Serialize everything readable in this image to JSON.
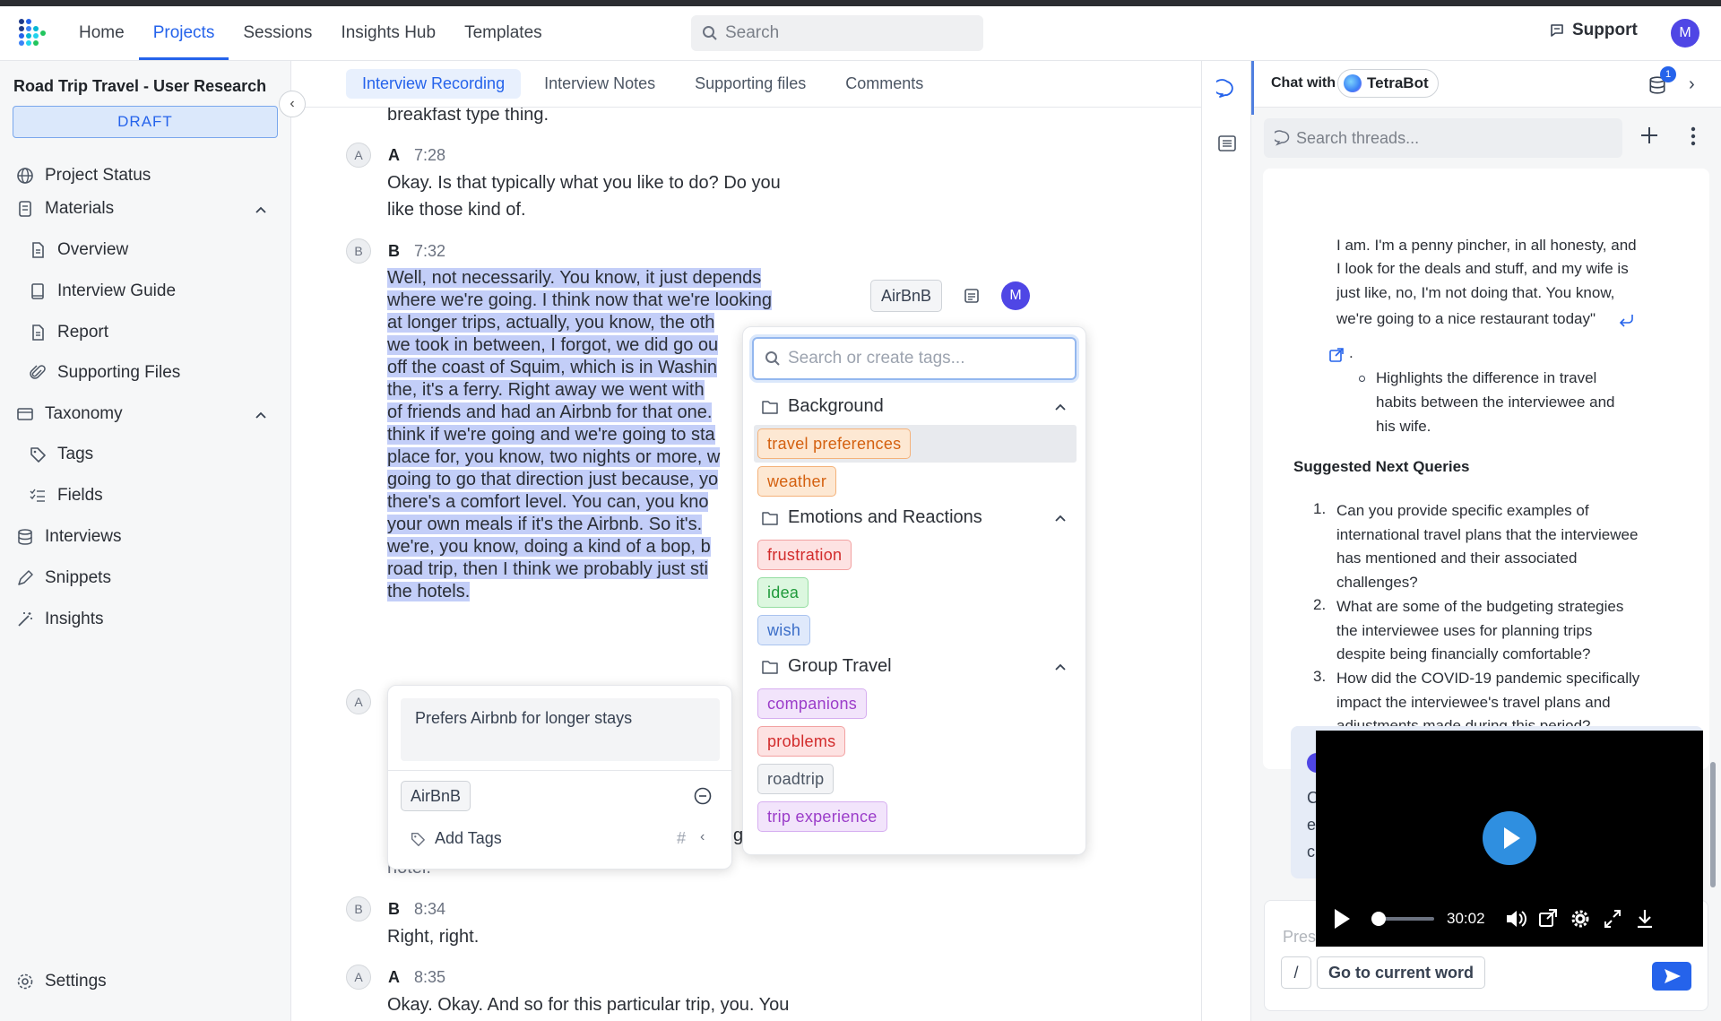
{
  "header": {
    "nav": [
      "Home",
      "Projects",
      "Sessions",
      "Insights Hub",
      "Templates"
    ],
    "active_nav": "Projects",
    "search_placeholder": "Search",
    "support_label": "Support",
    "user_initial": "M"
  },
  "sidebar": {
    "project_title": "Road Trip Travel - User Research",
    "status_badge": "DRAFT",
    "items": {
      "project_status": "Project Status",
      "materials": "Materials",
      "overview": "Overview",
      "interview_guide": "Interview Guide",
      "report": "Report",
      "supporting_files": "Supporting Files",
      "taxonomy": "Taxonomy",
      "tags": "Tags",
      "fields": "Fields",
      "interviews": "Interviews",
      "snippets": "Snippets",
      "insights": "Insights",
      "settings": "Settings"
    }
  },
  "tabs": [
    "Interview Recording",
    "Interview Notes",
    "Supporting files",
    "Comments"
  ],
  "active_tab": "Interview Recording",
  "transcript": {
    "top_line": "breakfast type thing.",
    "blocks": [
      {
        "badge": "A",
        "speaker": "A",
        "time": "7:28",
        "lines": [
          "Okay. Is that typically what you like to do? Do you",
          "like those kind of."
        ]
      },
      {
        "badge": "B",
        "speaker": "B",
        "time": "7:32",
        "lines": [
          "Well, not necessarily. You know, it just depends",
          "where we're going. I think now that we're looking",
          "at longer trips, actually, you know, the oth",
          "we took in between, I forgot, we did go ou",
          "off the coast of Squim, which is in Washin",
          "the, it's a ferry. Right away we went with",
          "of friends and had an Airbnb for that one.",
          "think if we're going and we're going to sta",
          "place for, you know, two nights or more, w",
          "going to go that direction just because, yo",
          "there's a comfort level. You can, you kno",
          "your own meals if it's the Airbnb. So it's.",
          "we're, you know, doing a kind of a bop, b",
          "road trip, then I think we probably just sti",
          "the hotels."
        ]
      },
      {
        "badge": "A",
        "speaker": "",
        "time": "",
        "lines": []
      },
      {
        "badge": "B",
        "speaker": "B",
        "time": "8:34",
        "lines": [
          "Right, right."
        ]
      },
      {
        "badge": "A",
        "speaker": "A",
        "time": "8:35",
        "lines": [
          "Okay. Okay. And so for this particular trip, you. You"
        ]
      }
    ],
    "partial_hotel": "hotel.",
    "partial_g": "g",
    "partial_c": "c",
    "selection_tag": "AirBnB",
    "selection_user": "M"
  },
  "snippet": {
    "text": "Prefers Airbnb for longer stays",
    "tag": "AirBnB",
    "add_tags_label": "Add Tags",
    "hash": "#",
    "back": "‹"
  },
  "tag_picker": {
    "placeholder": "Search or create tags...",
    "groups": [
      {
        "name": "Background",
        "tags": [
          "travel preferences",
          "weather"
        ]
      },
      {
        "name": "Emotions and Reactions",
        "tags": [
          "frustration",
          "idea",
          "wish"
        ]
      },
      {
        "name": "Group Travel",
        "tags": [
          "companions",
          "problems",
          "roadtrip",
          "trip experience"
        ]
      }
    ],
    "tag_colors": {
      "travel preferences": "orange",
      "weather": "orange",
      "frustration": "red",
      "idea": "green",
      "wish": "blue",
      "companions": "purple",
      "problems": "red",
      "roadtrip": "gray",
      "trip experience": "purple"
    }
  },
  "chat": {
    "title": "Chat with",
    "bot_name": "TetraBot",
    "notif_count": "1",
    "search_placeholder": "Search threads...",
    "answer_lines": [
      "I am. I'm a penny pincher, in all honesty, and",
      "I look for the deals and stuff, and my wife is",
      "just like, no, I'm not doing that. You know,",
      "we're going to a nice restaurant today\""
    ],
    "period": ".",
    "bullet_lines": [
      "Highlights the difference in travel",
      "habits between the interviewee and",
      "his wife."
    ],
    "next_queries_title": "Suggested Next Queries",
    "queries": [
      {
        "n": "1.",
        "lines": [
          "Can you provide specific examples of",
          "international travel plans that the interviewee",
          "has mentioned and their associated",
          "challenges?"
        ]
      },
      {
        "n": "2.",
        "lines": [
          "What are some of the budgeting strategies",
          "the interviewee uses for planning trips",
          "despite being financially comfortable?"
        ]
      },
      {
        "n": "3.",
        "lines": [
          "How did the COVID-19 pandemic specifically",
          "impact the interviewee's travel plans and",
          "adjustments made during this period?"
        ]
      }
    ],
    "input_hint": "Pres",
    "slash": "/",
    "goto_label": "Go to current word",
    "behind_letters": [
      "C",
      "e",
      "c"
    ]
  },
  "video": {
    "time": "30:02",
    "progress": 0.03
  },
  "colors": {
    "accent": "#2563eb",
    "highlight": "#c3cef8"
  }
}
